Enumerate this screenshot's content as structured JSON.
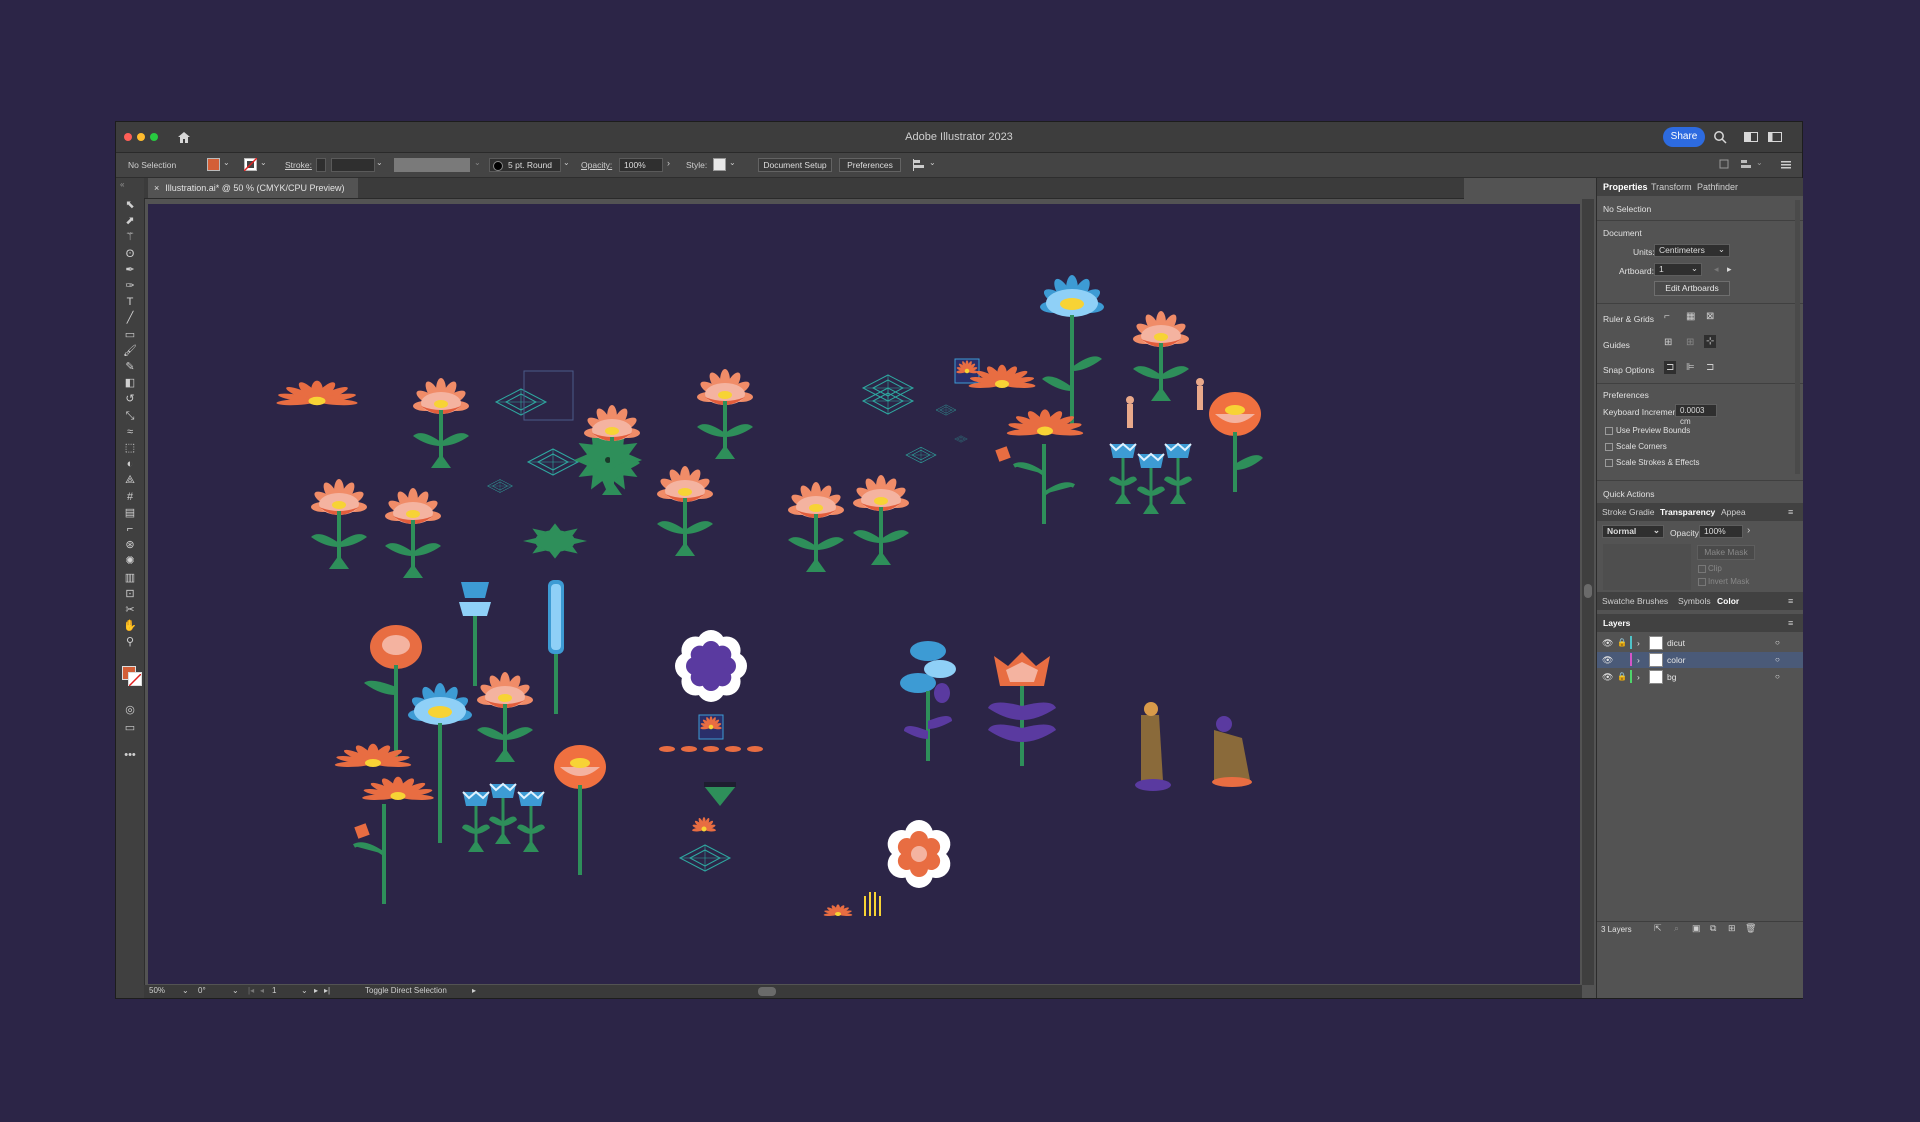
{
  "window": {
    "title": "Adobe Illustrator 2023",
    "share_label": "Share"
  },
  "control_bar": {
    "selection_label": "No Selection",
    "stroke_label": "Stroke:",
    "brush_label": "5 pt. Round",
    "opacity_label": "Opacity:",
    "opacity_value": "100%",
    "style_label": "Style:",
    "document_setup": "Document Setup",
    "preferences": "Preferences",
    "fill_color": "#d35f37"
  },
  "document_tab": {
    "close": "×",
    "title": "Illustration.ai* @ 50 % (CMYK/CPU Preview)"
  },
  "tools": [
    "selection-icon",
    "direct-selection-icon",
    "magic-wand-icon",
    "lasso-icon",
    "pen-icon",
    "curvature-icon",
    "type-icon",
    "line-icon",
    "rectangle-icon",
    "paintbrush-icon",
    "shaper-icon",
    "eraser-icon",
    "rotate-icon",
    "scale-icon",
    "warp-icon",
    "free-transform-icon",
    "shape-builder-icon",
    "perspective-icon",
    "mesh-icon",
    "gradient-icon",
    "eyedropper-icon",
    "blend-icon",
    "symbol-sprayer-icon",
    "graph-icon",
    "artboard-icon",
    "slice-icon",
    "hand-icon",
    "zoom-icon"
  ],
  "status_bar": {
    "zoom": "50%",
    "rotation": "0°",
    "artboard": "1",
    "tool_hint": "Toggle Direct Selection"
  },
  "properties_panel": {
    "tabs": [
      "Properties",
      "Transform",
      "Pathfinder"
    ],
    "selection": "No Selection",
    "document_heading": "Document",
    "units_label": "Units:",
    "units_value": "Centimeters",
    "artboard_label": "Artboard:",
    "artboard_value": "1",
    "edit_artboards": "Edit Artboards",
    "ruler_grids": "Ruler & Grids",
    "guides": "Guides",
    "snap_options": "Snap Options",
    "preferences_heading": "Preferences",
    "keyboard_increment_label": "Keyboard Increment:",
    "keyboard_increment_value": "0.0003 cm",
    "use_preview_bounds": "Use Preview Bounds",
    "scale_corners": "Scale Corners",
    "scale_strokes": "Scale Strokes & Effects",
    "quick_actions": "Quick Actions"
  },
  "transparency_panel": {
    "tabs": [
      "Stroke",
      "Gradie",
      "Transparency",
      "Appea"
    ],
    "blend_mode": "Normal",
    "opacity_label": "Opacity:",
    "opacity_value": "100%",
    "make_mask": "Make Mask",
    "clip": "Clip",
    "invert_mask": "Invert Mask"
  },
  "color_tabs": [
    "Swatche",
    "Brushes",
    "Symbols",
    "Color"
  ],
  "layers_panel": {
    "title": "Layers",
    "layers": [
      {
        "name": "dicut",
        "color": "#4fc3c8"
      },
      {
        "name": "color",
        "color": "#d455c8"
      },
      {
        "name": "bg",
        "color": "#4fd46b"
      }
    ],
    "count": "3 Layers"
  }
}
